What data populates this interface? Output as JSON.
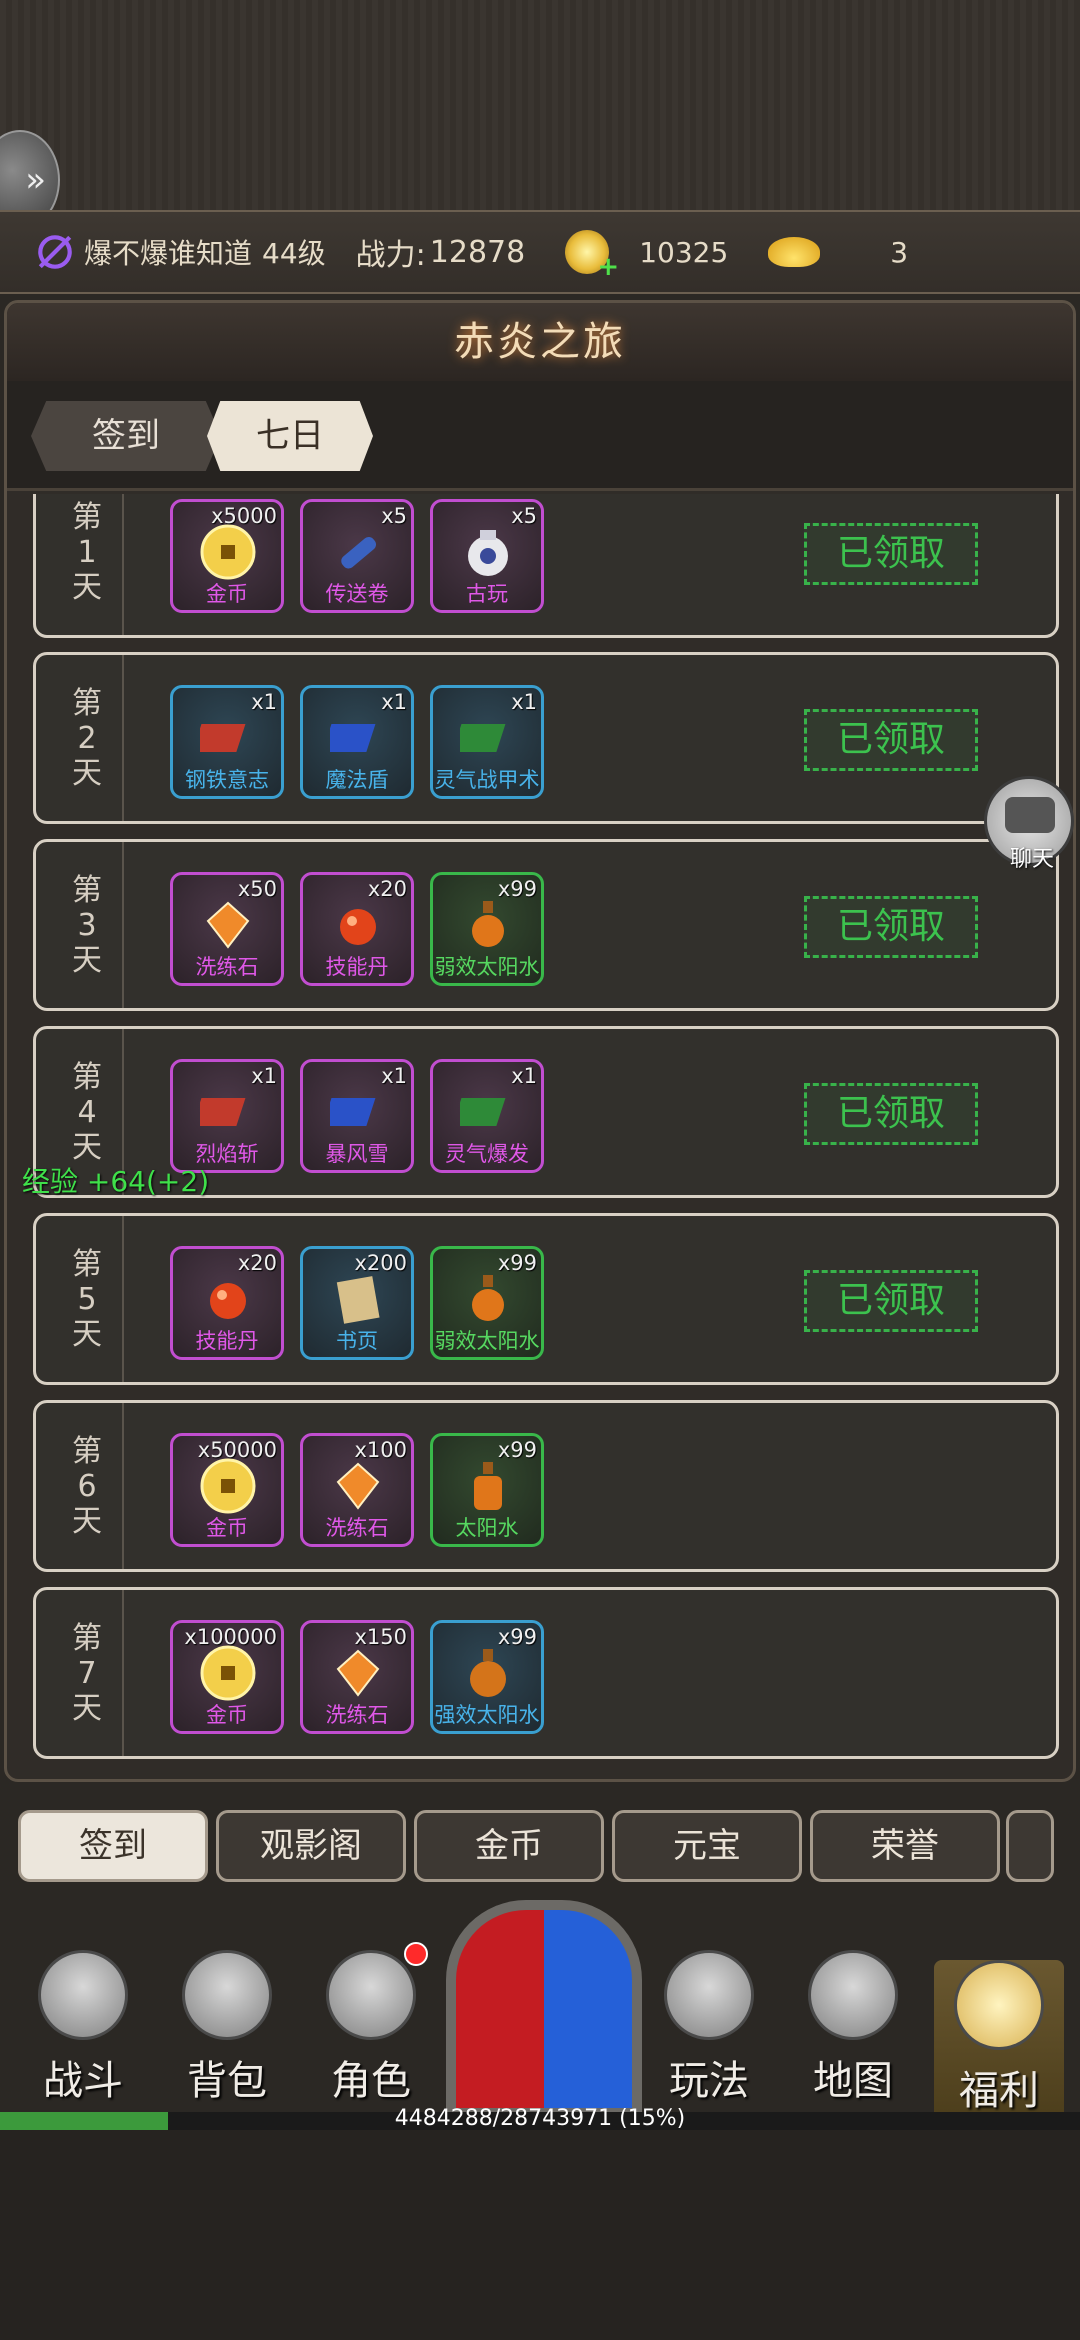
{
  "status": {
    "player_name": "爆不爆谁知道",
    "level": "44级",
    "power_label": "战力:",
    "power": "12878",
    "coins": "10325",
    "ingots": "3"
  },
  "panel": {
    "title": "赤炎之旅",
    "tabs": [
      "签到",
      "七日"
    ]
  },
  "days": [
    {
      "label": [
        "第",
        "1",
        "天"
      ],
      "claim": "已领取",
      "items": [
        {
          "name": "金币",
          "qty": "x5000",
          "rarity": "purple",
          "icon": "gold-coin-icon"
        },
        {
          "name": "传送卷",
          "qty": "x5",
          "rarity": "purple",
          "icon": "scroll-icon"
        },
        {
          "name": "古玩",
          "qty": "x5",
          "rarity": "purple",
          "icon": "vase-icon"
        }
      ]
    },
    {
      "label": [
        "第",
        "2",
        "天"
      ],
      "claim": "已领取",
      "items": [
        {
          "name": "钢铁意志",
          "qty": "x1",
          "rarity": "blue",
          "icon": "red-book-icon"
        },
        {
          "name": "魔法盾",
          "qty": "x1",
          "rarity": "blue",
          "icon": "blue-book-icon"
        },
        {
          "name": "灵气战甲术",
          "qty": "x1",
          "rarity": "blue",
          "icon": "green-book-icon"
        }
      ]
    },
    {
      "label": [
        "第",
        "3",
        "天"
      ],
      "claim": "已领取",
      "items": [
        {
          "name": "洗练石",
          "qty": "x50",
          "rarity": "purple",
          "icon": "gem-icon"
        },
        {
          "name": "技能丹",
          "qty": "x20",
          "rarity": "purple",
          "icon": "pill-icon"
        },
        {
          "name": "弱效太阳水",
          "qty": "x99",
          "rarity": "green",
          "icon": "potion-icon"
        }
      ]
    },
    {
      "label": [
        "第",
        "4",
        "天"
      ],
      "claim": "已领取",
      "items": [
        {
          "name": "烈焰斩",
          "qty": "x1",
          "rarity": "purple",
          "icon": "red-book-icon"
        },
        {
          "name": "暴风雪",
          "qty": "x1",
          "rarity": "purple",
          "icon": "blue-book-icon"
        },
        {
          "name": "灵气爆发",
          "qty": "x1",
          "rarity": "purple",
          "icon": "green-book-icon"
        }
      ]
    },
    {
      "label": [
        "第",
        "5",
        "天"
      ],
      "claim": "已领取",
      "items": [
        {
          "name": "技能丹",
          "qty": "x20",
          "rarity": "purple",
          "icon": "pill-icon"
        },
        {
          "name": "书页",
          "qty": "x200",
          "rarity": "blue",
          "icon": "page-icon"
        },
        {
          "name": "弱效太阳水",
          "qty": "x99",
          "rarity": "green",
          "icon": "potion-icon"
        }
      ]
    },
    {
      "label": [
        "第",
        "6",
        "天"
      ],
      "claim": "",
      "items": [
        {
          "name": "金币",
          "qty": "x50000",
          "rarity": "purple",
          "icon": "gold-coin-icon"
        },
        {
          "name": "洗练石",
          "qty": "x100",
          "rarity": "purple",
          "icon": "gem-icon"
        },
        {
          "name": "太阳水",
          "qty": "x99",
          "rarity": "green",
          "icon": "potion-icon"
        }
      ]
    },
    {
      "label": [
        "第",
        "7",
        "天"
      ],
      "claim": "",
      "items": [
        {
          "name": "金币",
          "qty": "x100000",
          "rarity": "purple",
          "icon": "gold-coin-icon"
        },
        {
          "name": "洗练石",
          "qty": "x150",
          "rarity": "purple",
          "icon": "gem-icon"
        },
        {
          "name": "强效太阳水",
          "qty": "x99",
          "rarity": "blue",
          "icon": "potion-icon"
        }
      ]
    }
  ],
  "exp_float": "经验 +64(+2)",
  "chat_label": "聊天",
  "sub_tabs": [
    "签到",
    "观影阁",
    "金币",
    "元宝",
    "荣誉"
  ],
  "nav": [
    "战斗",
    "背包",
    "角色",
    "玩法",
    "地图",
    "福利"
  ],
  "xp": {
    "text": "4484288/28743971 (15%)",
    "fraction": 0.156
  }
}
